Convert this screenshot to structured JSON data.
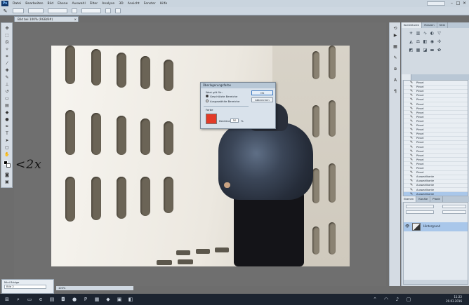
{
  "app": {
    "logo": "Ps",
    "menu": [
      "Datei",
      "Bearbeiten",
      "Bild",
      "Ebene",
      "Auswahl",
      "Filter",
      "Analyse",
      "3D",
      "Ansicht",
      "Fenster",
      "Hilfe"
    ],
    "workspace": "Grundelemente"
  },
  "document": {
    "tab_title": "Bild bei 100% (RGB/8#)",
    "close": "×"
  },
  "dialog": {
    "title": "Überlagerungsfarbe",
    "group_title": "Wert gilt für:",
    "option_1": "Geschützte Bereiche",
    "option_2": "Ausgewählte Bereiche",
    "ok": "OK",
    "cancel": "Abbrechen",
    "color_group": "Farbe",
    "opacity_label": "Deckkraft:",
    "opacity_value": "50",
    "opacity_unit": "%",
    "color_hex": "#e33b28"
  },
  "annotation": {
    "text": "2x"
  },
  "panels": {
    "tabs": [
      "Korrekturen",
      "Masken",
      "Stile"
    ],
    "history_items": [
      "Pinsel",
      "Pinsel",
      "Pinsel",
      "Pinsel",
      "Pinsel",
      "Pinsel",
      "Pinsel",
      "Pinsel",
      "Pinsel",
      "Pinsel",
      "Pinsel",
      "Pinsel",
      "Pinsel",
      "Pinsel",
      "Pinsel",
      "Pinsel",
      "Pinsel",
      "Pinsel",
      "Pinsel",
      "Pinsel",
      "Pinsel",
      "Pinsel",
      "Auswahlkante",
      "Auswahlkante",
      "Auswahlkante",
      "Auswahlkante",
      "Auswahlkante"
    ],
    "history_selected_index": 26,
    "layer_tabs": [
      "Ebenen",
      "Kanäle",
      "Pfade"
    ],
    "layer_name": "Hintergrund"
  },
  "minipanel": {
    "title": "Mini Bridge",
    "row": "Bild 2"
  },
  "statusbar": {
    "text": "100%"
  },
  "taskbar": {
    "clock": "11:22",
    "date": "20.03.2016"
  }
}
